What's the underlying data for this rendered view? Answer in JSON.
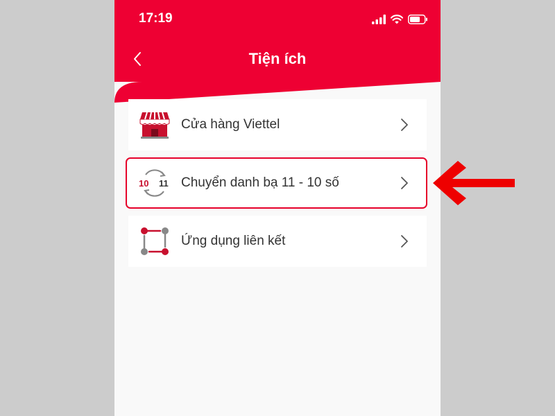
{
  "status_bar": {
    "time": "17:19",
    "icons": [
      "signal-icon",
      "wifi-icon",
      "battery-icon"
    ]
  },
  "header": {
    "title": "Tiện ích",
    "back_icon": "chevron-left-icon"
  },
  "menu": {
    "items": [
      {
        "label": "Cửa hàng Viettel",
        "icon": "store-icon"
      },
      {
        "label": "Chuyển danh bạ 11 - 10 số",
        "icon": "contacts-convert-icon",
        "icon_text_left": "10",
        "icon_text_right": "11"
      },
      {
        "label": "Ứng dụng liên kết",
        "icon": "linked-apps-icon"
      }
    ]
  },
  "annotation": {
    "highlighted_item": "Chuyển danh bạ 11 - 10 số",
    "arrow_color": "#ee0000"
  },
  "colors": {
    "brand_red": "#ee0033",
    "background": "#f9f9f9",
    "outer_background": "#cccccc"
  }
}
